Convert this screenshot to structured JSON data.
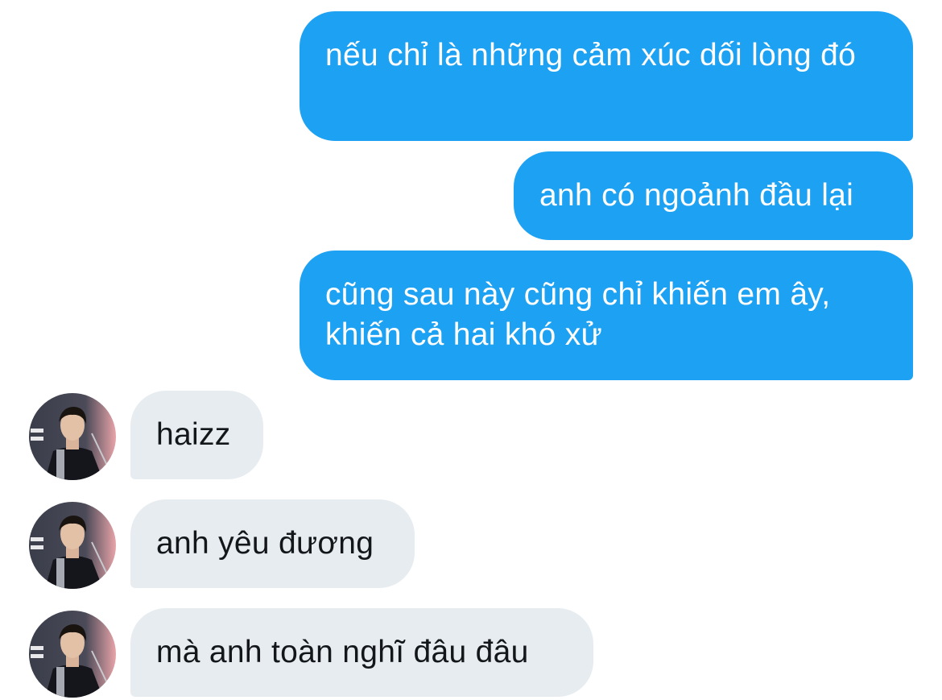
{
  "conversation": {
    "messages": [
      {
        "from": "me",
        "text": "nếu chỉ là những cảm xúc dối lòng đó"
      },
      {
        "from": "me",
        "text": "anh có ngoảnh đầu lại"
      },
      {
        "from": "me",
        "text": "cũng sau này cũng chỉ khiến em ây, khiến cả hai khó xử"
      },
      {
        "from": "them",
        "text": "haizz",
        "avatar": "profile-photo"
      },
      {
        "from": "them",
        "text": "anh yêu đương",
        "avatar": "profile-photo"
      },
      {
        "from": "them",
        "text": "mà anh toàn nghĩ đâu đâu",
        "avatar": "profile-photo"
      }
    ]
  },
  "colors": {
    "sent_bubble": "#1da1f2",
    "sent_text": "#ffffff",
    "received_bubble": "#e6ecf0",
    "received_text": "#14171a"
  }
}
